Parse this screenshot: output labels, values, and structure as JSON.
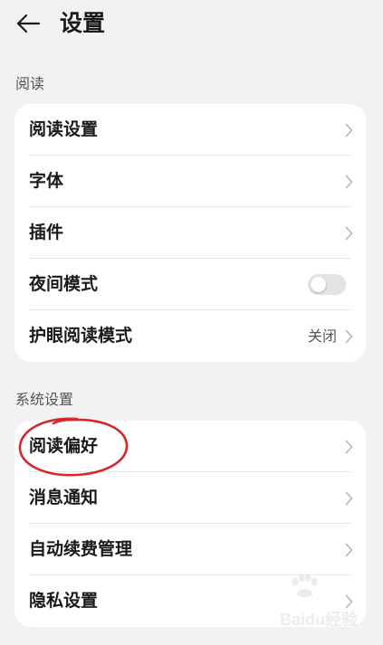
{
  "header": {
    "title": "设置",
    "back_icon": "arrow-left-icon"
  },
  "sections": [
    {
      "label": "阅读",
      "items": [
        {
          "label": "阅读设置",
          "type": "chevron"
        },
        {
          "label": "字体",
          "type": "chevron"
        },
        {
          "label": "插件",
          "type": "chevron"
        },
        {
          "label": "夜间模式",
          "type": "toggle",
          "on": false
        },
        {
          "label": "护眼阅读模式",
          "type": "chevron",
          "value": "关闭"
        }
      ]
    },
    {
      "label": "系统设置",
      "items": [
        {
          "label": "阅读偏好",
          "type": "chevron"
        },
        {
          "label": "消息通知",
          "type": "chevron"
        },
        {
          "label": "自动续费管理",
          "type": "chevron"
        },
        {
          "label": "隐私设置",
          "type": "chevron"
        }
      ]
    }
  ],
  "annotation": {
    "color": "#d9252a",
    "target": "阅读偏好"
  },
  "watermark": {
    "text": "Baidu经验",
    "color": "#999999"
  }
}
